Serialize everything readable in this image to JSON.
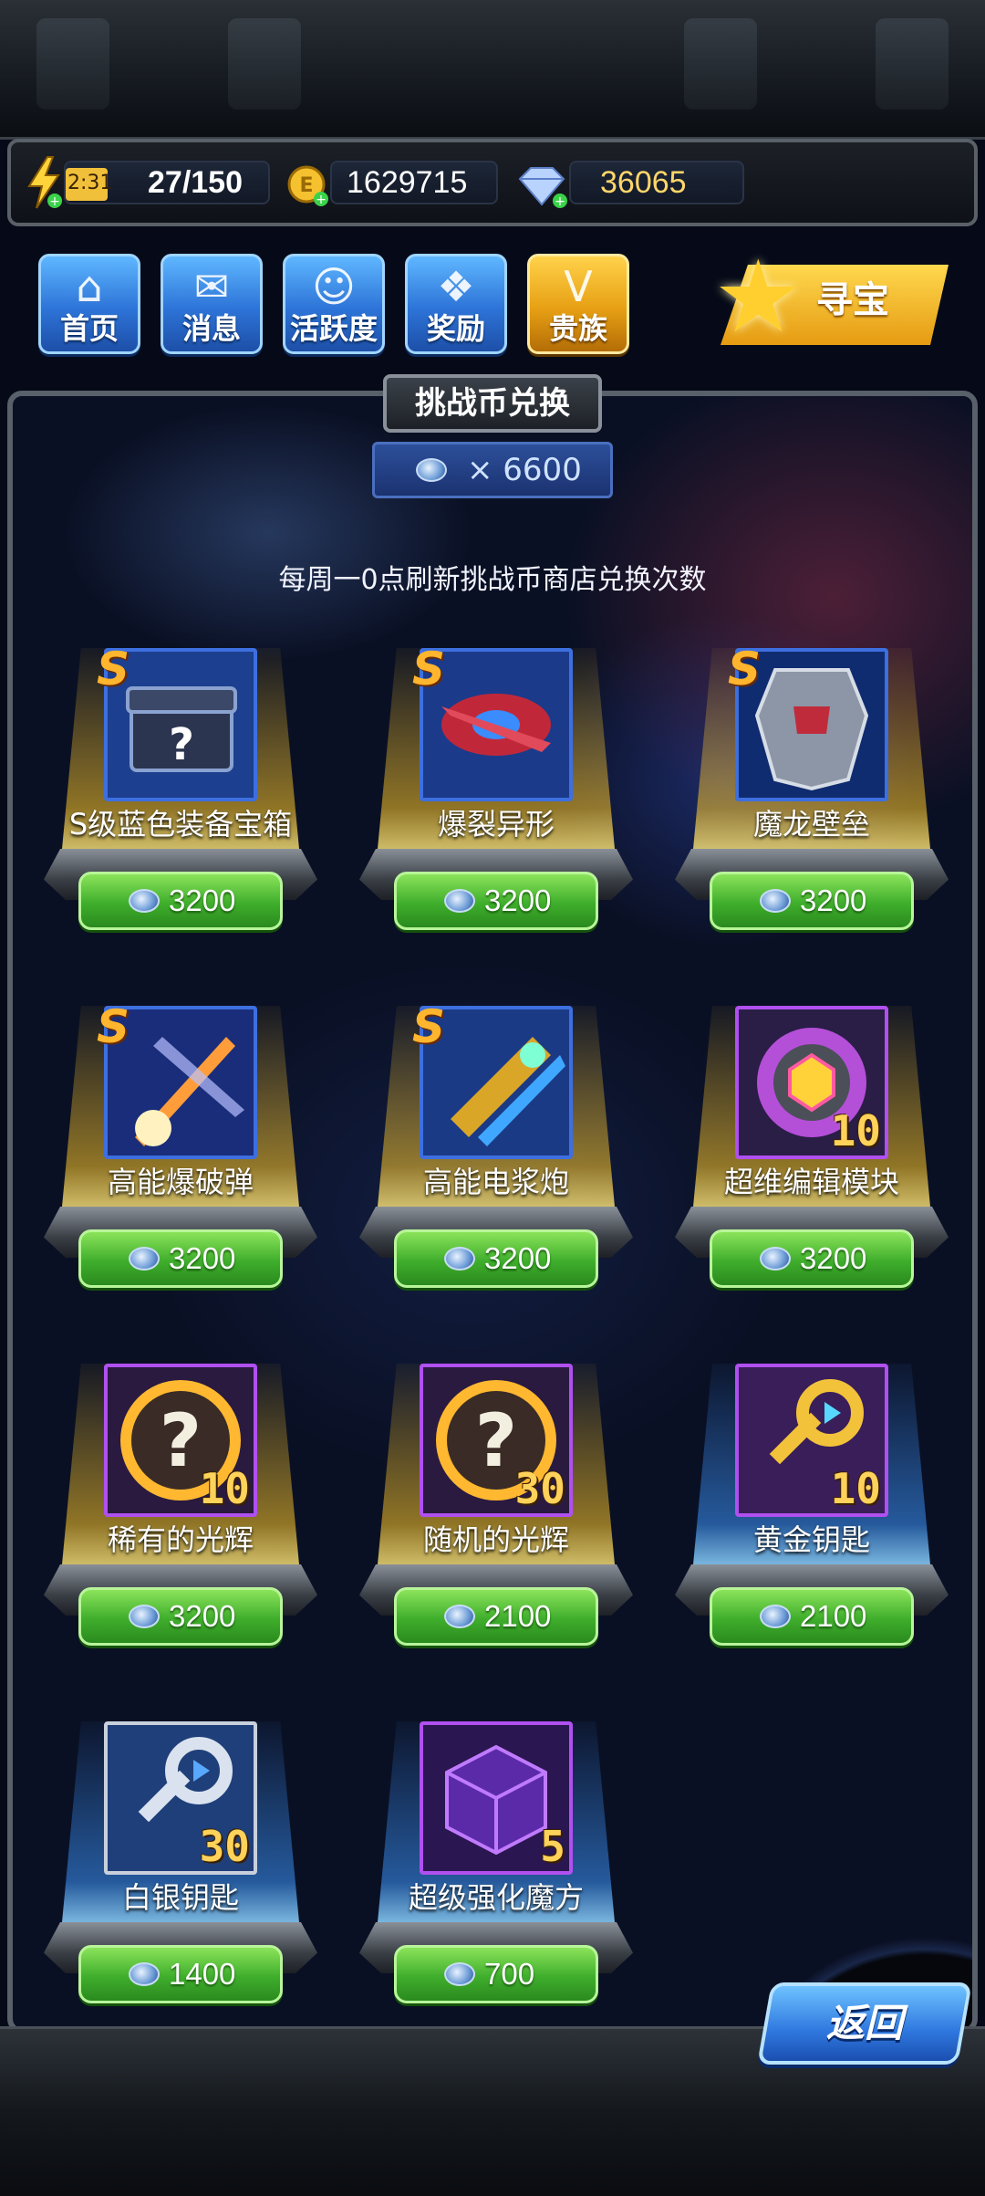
{
  "resources": {
    "energy_timer": "2:31",
    "energy": "27/150",
    "gold": "1629715",
    "diamonds": "36065"
  },
  "nav": [
    {
      "label": "首页",
      "icon": "home-icon"
    },
    {
      "label": "消息",
      "icon": "mail-icon"
    },
    {
      "label": "活跃度",
      "icon": "smile-badge-icon"
    },
    {
      "label": "奖励",
      "icon": "gift-icon"
    },
    {
      "label": "贵族",
      "icon": "noble-v-icon"
    }
  ],
  "treasure_label": "寻宝",
  "panel": {
    "title": "挑战币兑换",
    "currency_amount": "× 6600",
    "notice": "每周一0点刷新挑战币商店兑换次数"
  },
  "items": [
    {
      "name": "S级蓝色装备宝箱",
      "price": "3200",
      "grade": "S",
      "count": "",
      "icon": "mystery-chest-icon",
      "beam": "gold"
    },
    {
      "name": "爆裂异形",
      "price": "3200",
      "grade": "S",
      "count": "",
      "icon": "red-fighter-icon",
      "beam": "gold"
    },
    {
      "name": "魔龙壁垒",
      "price": "3200",
      "grade": "S",
      "count": "",
      "icon": "armor-shield-icon",
      "beam": "gold"
    },
    {
      "name": "高能爆破弹",
      "price": "3200",
      "grade": "S",
      "count": "",
      "icon": "missile-barrage-icon",
      "beam": "gold"
    },
    {
      "name": "高能电浆炮",
      "price": "3200",
      "grade": "S",
      "count": "",
      "icon": "plasma-cannon-icon",
      "beam": "gold"
    },
    {
      "name": "超维编辑模块",
      "price": "3200",
      "grade": "",
      "count": "10",
      "icon": "gem-module-icon",
      "beam": "gold"
    },
    {
      "name": "稀有的光辉",
      "price": "3200",
      "grade": "",
      "count": "10",
      "icon": "question-orb-icon",
      "beam": "gold"
    },
    {
      "name": "随机的光辉",
      "price": "2100",
      "grade": "",
      "count": "30",
      "icon": "question-orb-icon",
      "beam": "gold"
    },
    {
      "name": "黄金钥匙",
      "price": "2100",
      "grade": "",
      "count": "10",
      "icon": "gold-key-icon",
      "beam": "blue"
    },
    {
      "name": "白银钥匙",
      "price": "1400",
      "grade": "",
      "count": "30",
      "icon": "silver-key-icon",
      "beam": "blue"
    },
    {
      "name": "超级强化魔方",
      "price": "700",
      "grade": "",
      "count": "5",
      "icon": "purple-cube-icon",
      "beam": "blue"
    }
  ],
  "back_label": "返回"
}
